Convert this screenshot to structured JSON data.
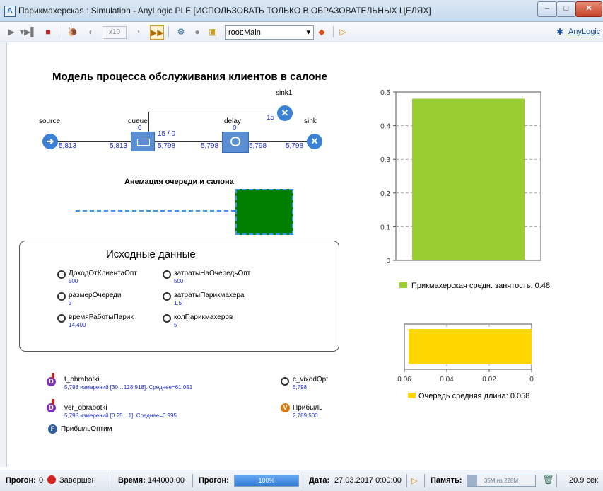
{
  "window": {
    "title": "Парикмахерская : Simulation - AnyLogic PLE [ИСПОЛЬЗОВАТЬ ТОЛЬКО В ОБРАЗОВАТЕЛЬНЫХ ЦЕЛЯХ]",
    "minimize": "–",
    "maximize": "□",
    "close": "✕"
  },
  "toolbar": {
    "speed": "x10",
    "root": "root:Main",
    "brand": "AnyLogic"
  },
  "model": {
    "title": "Модель процесса обслуживания клиентов в салоне",
    "nodes": {
      "source": "source",
      "queue": "queue",
      "delay": "delay",
      "sink": "sink",
      "sink1": "sink1"
    },
    "counts": {
      "source_out": "5,813",
      "queue_in": "5,813",
      "queue_count": "0",
      "queue_capacity": "15 / 0",
      "queue_out": "5,798",
      "delay_in": "5,798",
      "delay_count": "0",
      "delay_out": "5,798",
      "sink_in": "5,798",
      "sink1_in": "15"
    },
    "animation_title": "Анемация очереди и салона"
  },
  "params": {
    "title": "Исходные данные",
    "items": [
      {
        "name": "ДоходОтКлиентаОпт",
        "value": "500"
      },
      {
        "name": "затратыНаОчередьОпт",
        "value": "500"
      },
      {
        "name": "размерОчереди",
        "value": "3"
      },
      {
        "name": "затратыПарикмахера",
        "value": "1.5"
      },
      {
        "name": "времяРаботыПарик",
        "value": "14,400"
      },
      {
        "name": "колПарикмахеров",
        "value": "5"
      }
    ]
  },
  "stats": {
    "t_obrabotki_name": "t_obrabotki",
    "t_obrabotki_value": "5,798 измерений [30…128.918]. Среднее=61.051",
    "ver_obrabotki_name": "ver_obrabotki",
    "ver_obrabotki_value": "5,798 измерений [0.25…1]. Среднее=0.995",
    "c_vixodOpt_name": "c_vixodOpt",
    "c_vixodOpt_value": "5,798",
    "pribyl_name": "Прибыль",
    "pribyl_value": "2,789,500",
    "pribyl_optim": "ПрибыльОптим"
  },
  "colors": {
    "bar_green": "#9acd32",
    "bar_yellow": "#ffd700",
    "accent_blue": "#3c82d4"
  },
  "chart_data": [
    {
      "type": "bar",
      "orientation": "vertical",
      "categories": [
        ""
      ],
      "series": [
        {
          "name": "Прикмахерская средн. занятость: 0.48",
          "values": [
            0.48
          ]
        }
      ],
      "ylim": [
        0,
        0.5
      ],
      "yticks": [
        "0",
        "0.1",
        "0.2",
        "0.3",
        "0.4",
        "0.5"
      ],
      "grid": true,
      "legend": "bottom"
    },
    {
      "type": "bar",
      "orientation": "horizontal-reversed",
      "categories": [
        ""
      ],
      "series": [
        {
          "name": "Очередь средняя длина: 0.058",
          "values": [
            0.058
          ]
        }
      ],
      "xlim": [
        0,
        0.06
      ],
      "xticks": [
        "0.06",
        "0.04",
        "0.02",
        "0"
      ],
      "grid": true,
      "legend": "bottom"
    }
  ],
  "status": {
    "run_label": "Прогон:",
    "run_value": "0",
    "state": "Завершен",
    "time_label": "Время:",
    "time_value": "144000.00",
    "progress_label": "Прогон:",
    "progress_value": "100%",
    "progress_fraction": 1.0,
    "date_label": "Дата:",
    "date_value": "27.03.2017 0:00:00",
    "memory_label": "Память:",
    "memory_value": "35M из 228M",
    "memory_fraction": 0.15,
    "elapsed": "20.9 сек"
  }
}
